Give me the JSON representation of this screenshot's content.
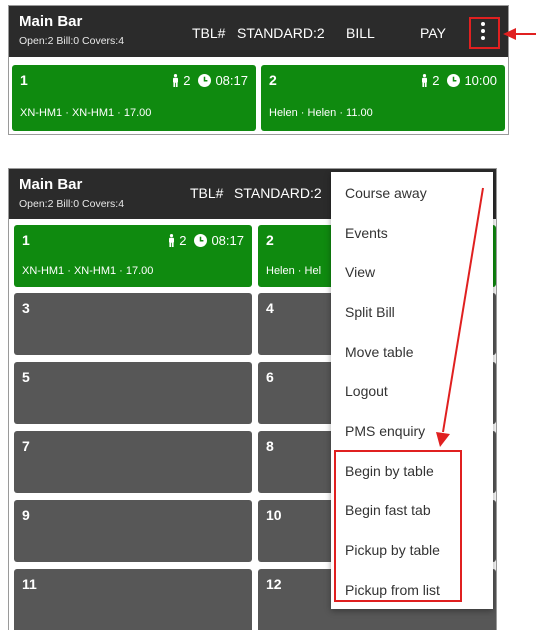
{
  "colors": {
    "bar": "#2b2b2b",
    "tile_open": "#0f8a0f",
    "tile_empty": "#575757",
    "annotation": "#e02020"
  },
  "before": {
    "appbar": {
      "title": "Main Bar",
      "subtitle": "Open:2 Bill:0 Covers:4",
      "tbl_label": "TBL#",
      "standard_label": "STANDARD:2",
      "bill_label": "BILL",
      "pay_label": "PAY",
      "menu_icon": "more-vert-icon"
    },
    "tables": [
      {
        "number": "1",
        "covers": "2",
        "time": "08:17",
        "detail": "XN-HM1 · XN-HM1 · 17.00",
        "status": "open"
      },
      {
        "number": "2",
        "covers": "2",
        "time": "10:00",
        "detail": "Helen · Helen · 11.00",
        "status": "open"
      }
    ]
  },
  "after": {
    "appbar": {
      "title": "Main Bar",
      "subtitle": "Open:2 Bill:0 Covers:4",
      "tbl_label": "TBL#",
      "standard_label": "STANDARD:2"
    },
    "tables": [
      {
        "number": "1",
        "covers": "2",
        "time": "08:17",
        "detail": "XN-HM1 · XN-HM1 · 17.00",
        "status": "open"
      },
      {
        "number": "2",
        "detail": "Helen · Hel",
        "status": "open"
      },
      {
        "number": "3",
        "status": "empty"
      },
      {
        "number": "4",
        "status": "empty"
      },
      {
        "number": "5",
        "status": "empty"
      },
      {
        "number": "6",
        "status": "empty"
      },
      {
        "number": "7",
        "status": "empty"
      },
      {
        "number": "8",
        "status": "empty"
      },
      {
        "number": "9",
        "status": "empty"
      },
      {
        "number": "10",
        "status": "empty"
      },
      {
        "number": "11",
        "status": "empty"
      },
      {
        "number": "12",
        "status": "empty"
      }
    ],
    "menu": {
      "items": [
        "Course away",
        "Events",
        "View",
        "Split Bill",
        "Move table",
        "Logout",
        "PMS enquiry",
        "Begin by table",
        "Begin fast tab",
        "Pickup by table",
        "Pickup from list"
      ]
    }
  }
}
